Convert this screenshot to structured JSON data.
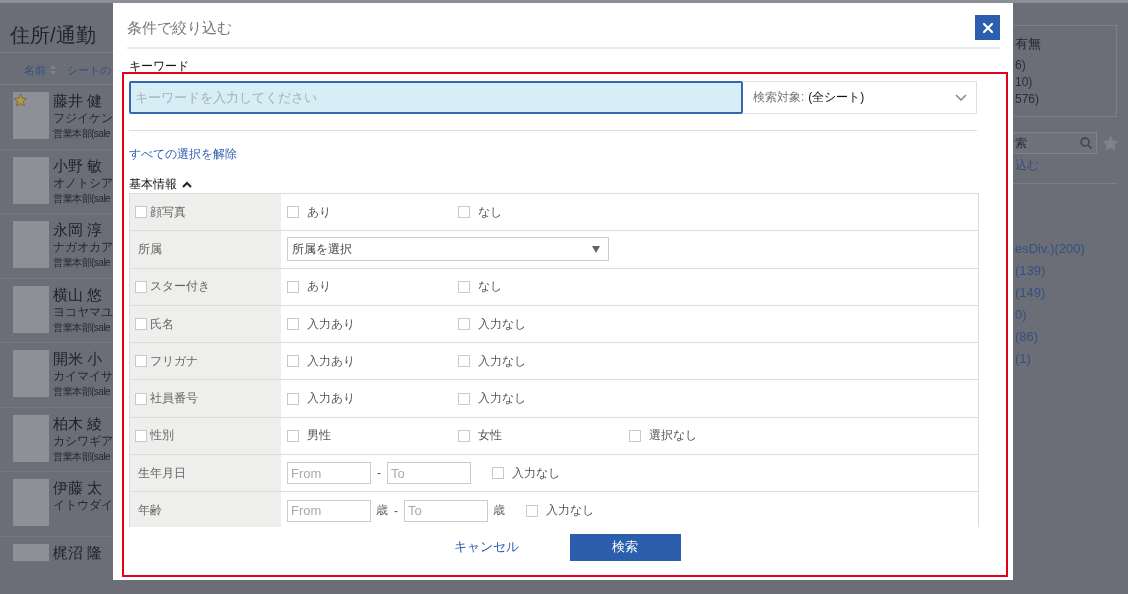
{
  "background": {
    "page_title": "住所/通勤",
    "sort_links": [
      {
        "label": "名前",
        "sort_icon": true
      },
      {
        "label": "シートの"
      }
    ],
    "people": [
      {
        "name": "藤井 健",
        "kana": "フジイケン",
        "department": "営業本部(sale",
        "starred": true
      },
      {
        "name": "小野 敏",
        "kana": "オノトシア",
        "department": "営業本部(sale",
        "starred": false
      },
      {
        "name": "永岡 淳",
        "kana": "ナガオカア",
        "department": "営業本部(sale",
        "starred": false
      },
      {
        "name": "横山 悠",
        "kana": "ヨコヤマユ",
        "department": "営業本部(sale",
        "starred": false
      },
      {
        "name": "開米 小",
        "kana": "カイマイサ",
        "department": "営業本部(sale",
        "starred": false
      },
      {
        "name": "柏木 綾",
        "kana": "カシワギア",
        "department": "営業本部(sale",
        "starred": false
      },
      {
        "name": "伊藤 太",
        "kana": "イトウダイ",
        "starred": false
      },
      {
        "name": "梶沼 隆",
        "starred": false
      }
    ],
    "side_panel": {
      "heading": "有無",
      "counts": [
        "6)",
        "10)",
        "576)"
      ],
      "search_placeholder": "索",
      "filter_link": "込む",
      "departments": [
        "esDiv.)(200)",
        "(139)",
        "(149)",
        "0)",
        "(86)",
        "(1)"
      ]
    }
  },
  "dialog": {
    "title": "条件で絞り込む",
    "keyword": {
      "label": "キーワード",
      "placeholder": "キーワードを入力してください",
      "focused": true
    },
    "scope": {
      "label": "検索対象:",
      "value": "(全シート)"
    },
    "clear_link": "すべての選択を解除",
    "section": {
      "title": "基本情報",
      "expanded": true,
      "rows": [
        {
          "kind": "options",
          "label": "顔写真",
          "checked": false,
          "options": [
            {
              "label": "あり",
              "checked": false
            },
            {
              "label": "なし",
              "checked": false
            }
          ]
        },
        {
          "kind": "select",
          "label": "所属",
          "value": "所属を選択"
        },
        {
          "kind": "options",
          "label": "スター付き",
          "checked": false,
          "options": [
            {
              "label": "あり",
              "checked": false
            },
            {
              "label": "なし",
              "checked": false
            }
          ]
        },
        {
          "kind": "options",
          "label": "氏名",
          "checked": false,
          "options": [
            {
              "label": "入力あり",
              "checked": false
            },
            {
              "label": "入力なし",
              "checked": false
            }
          ]
        },
        {
          "kind": "options",
          "label": "フリガナ",
          "checked": false,
          "options": [
            {
              "label": "入力あり",
              "checked": false
            },
            {
              "label": "入力なし",
              "checked": false
            }
          ]
        },
        {
          "kind": "options",
          "label": "社員番号",
          "checked": false,
          "options": [
            {
              "label": "入力あり",
              "checked": false
            },
            {
              "label": "入力なし",
              "checked": false
            }
          ]
        },
        {
          "kind": "options",
          "label": "性別",
          "checked": false,
          "options": [
            {
              "label": "男性",
              "checked": false
            },
            {
              "label": "女性",
              "checked": false
            },
            {
              "label": "選択なし",
              "checked": false
            }
          ]
        },
        {
          "kind": "range",
          "label": "生年月日",
          "from_placeholder": "From",
          "to_placeholder": "To",
          "separator": "-",
          "empty_option": {
            "label": "入力なし",
            "checked": false
          }
        },
        {
          "kind": "range",
          "label": "年齢",
          "from_placeholder": "From",
          "from_unit": "歳",
          "separator": "-",
          "to_placeholder": "To",
          "to_unit": "歳",
          "empty_option": {
            "label": "入力なし",
            "checked": false
          }
        }
      ]
    },
    "cancel_label": "キャンセル",
    "submit_label": "検索"
  }
}
